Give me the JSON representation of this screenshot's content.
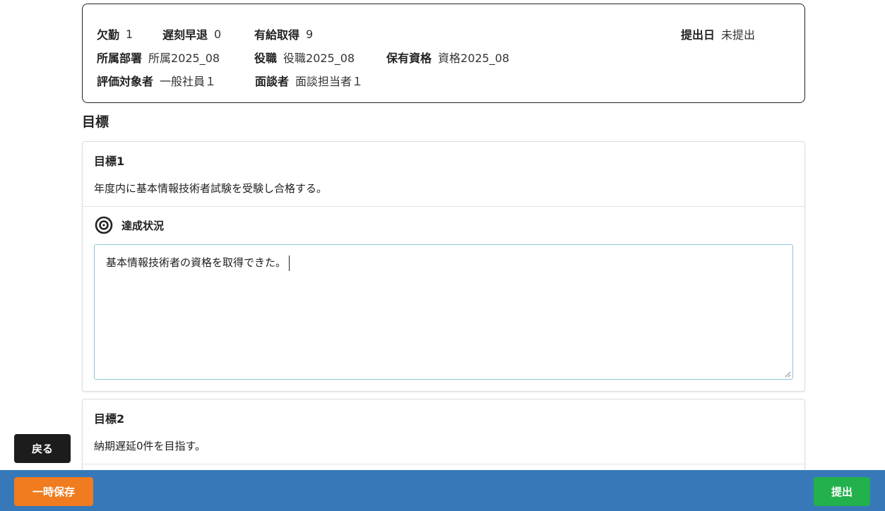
{
  "info": {
    "absence_label": "欠勤",
    "absence_value": "1",
    "late_label": "遅刻早退",
    "late_value": "0",
    "paid_leave_label": "有給取得",
    "paid_leave_value": "9",
    "submit_date_label": "提出日",
    "submit_date_value": "未提出",
    "department_label": "所属部署",
    "department_value": "所属2025_08",
    "position_label": "役職",
    "position_value": "役職2025_08",
    "qualification_label": "保有資格",
    "qualification_value": "資格2025_08",
    "evaluee_label": "評価対象者",
    "evaluee_value": "一般社員１",
    "interviewer_label": "面談者",
    "interviewer_value": "面談担当者１"
  },
  "section_title": "目標",
  "goals": [
    {
      "title": "目標1",
      "text": "年度内に基本情報技術者試験を受験し合格する。",
      "status_label": "達成状況",
      "status_icon": "target-icon",
      "status_text": "基本情報技術者の資格を取得できた。"
    },
    {
      "title": "目標2",
      "text": "納期遅延0件を目指す。"
    }
  ],
  "buttons": {
    "back": "戻る",
    "save": "一時保存",
    "submit": "提出"
  },
  "colors": {
    "footer": "#3778b9",
    "save": "#f07c1f",
    "submit": "#22b14c",
    "back": "#1c1c1c"
  }
}
